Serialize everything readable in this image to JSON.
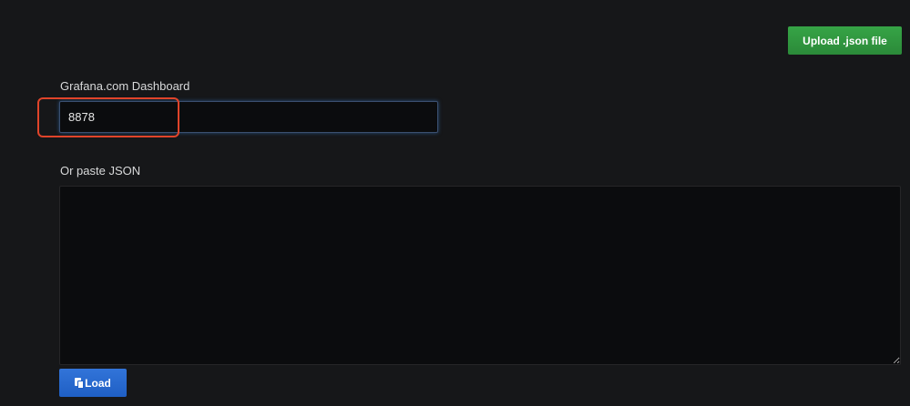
{
  "header": {
    "upload_button_label": "Upload .json file"
  },
  "grafana_com": {
    "label": "Grafana.com Dashboard",
    "input_value": "8878"
  },
  "json_import": {
    "label": "Or paste JSON",
    "textarea_value": ""
  },
  "load_button": {
    "label": "Load",
    "icon": "paste-icon"
  },
  "colors": {
    "background": "#161719",
    "upload_button": "#2b8a39",
    "load_button": "#1f5fc4",
    "highlight_annotation": "#e0442a"
  }
}
